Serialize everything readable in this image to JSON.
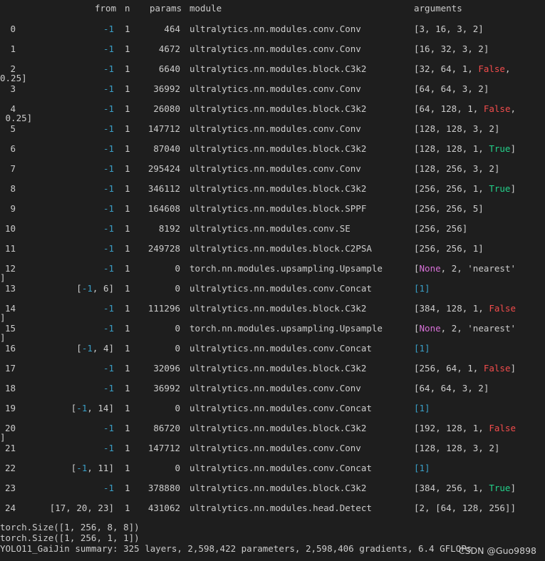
{
  "header": {
    "from": "from",
    "n": "n",
    "params": "params",
    "module": "module",
    "arguments": "arguments"
  },
  "rows": [
    {
      "idx": "0",
      "from": "-1",
      "n": "1",
      "params": "464",
      "module": "ultralytics.nn.modules.conv.Conv",
      "args": "[3, 16, 3, 2]"
    },
    {
      "idx": "1",
      "from": "-1",
      "n": "1",
      "params": "4672",
      "module": "ultralytics.nn.modules.conv.Conv",
      "args": "[16, 32, 3, 2]"
    },
    {
      "idx": "2",
      "from": "-1",
      "n": "1",
      "params": "6640",
      "module": "ultralytics.nn.modules.block.C3k2",
      "args_a": "[32, 64, 1, ",
      "args_b": "False",
      "args_c": ",",
      "wrap": "0.25]"
    },
    {
      "idx": "3",
      "from": "-1",
      "n": "1",
      "params": "36992",
      "module": "ultralytics.nn.modules.conv.Conv",
      "args": "[64, 64, 3, 2]"
    },
    {
      "idx": "4",
      "from": "-1",
      "n": "1",
      "params": "26080",
      "module": "ultralytics.nn.modules.block.C3k2",
      "args_a": "[64, 128, 1, ",
      "args_b": "False",
      "args_c": ",",
      "wrap": " 0.25]"
    },
    {
      "idx": "5",
      "from": "-1",
      "n": "1",
      "params": "147712",
      "module": "ultralytics.nn.modules.conv.Conv",
      "args": "[128, 128, 3, 2]"
    },
    {
      "idx": "6",
      "from": "-1",
      "n": "1",
      "params": "87040",
      "module": "ultralytics.nn.modules.block.C3k2",
      "args_a": "[128, 128, 1, ",
      "args_b": "True",
      "args_c": "]"
    },
    {
      "idx": "7",
      "from": "-1",
      "n": "1",
      "params": "295424",
      "module": "ultralytics.nn.modules.conv.Conv",
      "args": "[128, 256, 3, 2]"
    },
    {
      "idx": "8",
      "from": "-1",
      "n": "1",
      "params": "346112",
      "module": "ultralytics.nn.modules.block.C3k2",
      "args_a": "[256, 256, 1, ",
      "args_b": "True",
      "args_c": "]"
    },
    {
      "idx": "9",
      "from": "-1",
      "n": "1",
      "params": "164608",
      "module": "ultralytics.nn.modules.block.SPPF",
      "args": "[256, 256, 5]"
    },
    {
      "idx": "10",
      "from": "-1",
      "n": "1",
      "params": "8192",
      "module": "ultralytics.nn.modules.conv.SE",
      "args": "[256, 256]"
    },
    {
      "idx": "11",
      "from": "-1",
      "n": "1",
      "params": "249728",
      "module": "ultralytics.nn.modules.block.C2PSA",
      "args": "[256, 256, 1]"
    },
    {
      "idx": "12",
      "from": "-1",
      "n": "1",
      "params": "0",
      "module": "torch.nn.modules.upsampling.Upsample",
      "args_a": "[",
      "args_none": "None",
      "args_c": ", 2, 'nearest'",
      "wrap": "]"
    },
    {
      "idx": "13",
      "from_a": "[",
      "from_b": "-1",
      "from_c": ", 6]",
      "n": "1",
      "params": "0",
      "module": "ultralytics.nn.modules.conv.Concat",
      "args_list": "[1]"
    },
    {
      "idx": "14",
      "from": "-1",
      "n": "1",
      "params": "111296",
      "module": "ultralytics.nn.modules.block.C3k2",
      "args_a": "[384, 128, 1, ",
      "args_b": "False",
      "wrap": "]"
    },
    {
      "idx": "15",
      "from": "-1",
      "n": "1",
      "params": "0",
      "module": "torch.nn.modules.upsampling.Upsample",
      "args_a": "[",
      "args_none": "None",
      "args_c": ", 2, 'nearest'",
      "wrap": "]"
    },
    {
      "idx": "16",
      "from_a": "[",
      "from_b": "-1",
      "from_c": ", 4]",
      "n": "1",
      "params": "0",
      "module": "ultralytics.nn.modules.conv.Concat",
      "args_list": "[1]"
    },
    {
      "idx": "17",
      "from": "-1",
      "n": "1",
      "params": "32096",
      "module": "ultralytics.nn.modules.block.C3k2",
      "args_a": "[256, 64, 1, ",
      "args_b": "False",
      "args_c": "]"
    },
    {
      "idx": "18",
      "from": "-1",
      "n": "1",
      "params": "36992",
      "module": "ultralytics.nn.modules.conv.Conv",
      "args": "[64, 64, 3, 2]"
    },
    {
      "idx": "19",
      "from_a": "[",
      "from_b": "-1",
      "from_c": ", 14]",
      "n": "1",
      "params": "0",
      "module": "ultralytics.nn.modules.conv.Concat",
      "args_list": "[1]"
    },
    {
      "idx": "20",
      "from": "-1",
      "n": "1",
      "params": "86720",
      "module": "ultralytics.nn.modules.block.C3k2",
      "args_a": "[192, 128, 1, ",
      "args_b": "False",
      "wrap": "]"
    },
    {
      "idx": "21",
      "from": "-1",
      "n": "1",
      "params": "147712",
      "module": "ultralytics.nn.modules.conv.Conv",
      "args": "[128, 128, 3, 2]"
    },
    {
      "idx": "22",
      "from_a": "[",
      "from_b": "-1",
      "from_c": ", 11]",
      "n": "1",
      "params": "0",
      "module": "ultralytics.nn.modules.conv.Concat",
      "args_list": "[1]"
    },
    {
      "idx": "23",
      "from": "-1",
      "n": "1",
      "params": "378880",
      "module": "ultralytics.nn.modules.block.C3k2",
      "args_a": "[384, 256, 1, ",
      "args_b": "True",
      "args_c": "]"
    },
    {
      "idx": "24",
      "from_plain": "[17, 20, 23]",
      "n": "1",
      "params": "431062",
      "module": "ultralytics.nn.modules.head.Detect",
      "args": "[2, [64, 128, 256]]"
    }
  ],
  "footer": {
    "line1": "torch.Size([1, 256, 8, 8])",
    "line2": "torch.Size([1, 256, 1, 1])",
    "line3": "YOLO11_GaiJin summary: 325 layers, 2,598,422 parameters, 2,598,406 gradients, 6.4 GFLOPs"
  },
  "watermark": "CSDN @Guo9898",
  "colors": {
    "background": "#1e1e1e",
    "text": "#cccccc",
    "cyan": "#3aa0c8",
    "false_red": "#f14c4c",
    "true_green": "#23d18b",
    "none_magenta": "#d670d6"
  }
}
